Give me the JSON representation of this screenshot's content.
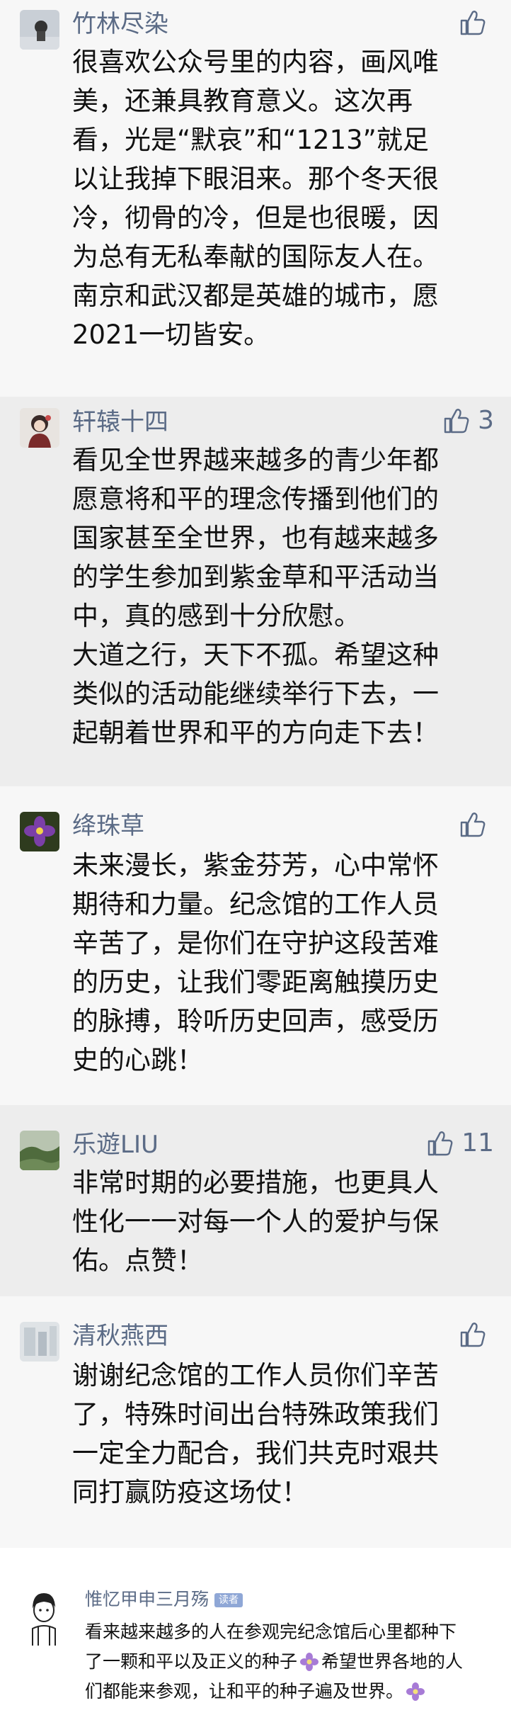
{
  "comments": [
    {
      "name": "竹林尽染",
      "likes": "",
      "lines": [
        "很喜欢公众号里的内容，画风唯",
        "美，还兼具教育意义。这次再",
        "看，光是“默哀”和“1213”就足",
        "以让我掉下眼泪来。那个冬天很",
        "冷，彻骨的冷，但是也很暖，因",
        "为总有无私奉献的国际友人在。",
        "南京和武汉都是英雄的城市，愿",
        "2021一切皆安。"
      ]
    },
    {
      "name": "轩辕十四",
      "likes": "3",
      "lines": [
        "看见全世界越来越多的青少年都",
        "愿意将和平的理念传播到他们的",
        "国家甚至全世界，也有越来越多",
        "的学生参加到紫金草和平活动当",
        "中，真的感到十分欣慰。",
        "大道之行，天下不孤。希望这种",
        "类似的活动能继续举行下去，一",
        "起朝着世界和平的方向走下去！"
      ]
    },
    {
      "name": "绛珠草",
      "likes": "",
      "lines": [
        "未来漫长，紫金芬芳，心中常怀",
        "期待和力量。纪念馆的工作人员",
        "辛苦了，是你们在守护这段苦难",
        "的历史，让我们零距离触摸历史",
        "的脉搏，聆听历史回声，感受历",
        "史的心跳！"
      ]
    },
    {
      "name": "乐遊LIU",
      "likes": "11",
      "lines": [
        "非常时期的必要措施，也更具人",
        "性化一一对每一个人的爱护与保",
        "佑。点赞！"
      ]
    },
    {
      "name": "清秋燕西",
      "likes": "",
      "lines": [
        "谢谢纪念馆的工作人员你们辛苦",
        "了，特殊时间出台特殊政策我们",
        "一定全力配合，我们共克时艰共",
        "同打赢防疫这场仗！"
      ]
    }
  ],
  "last_comment": {
    "name": "惟忆甲申三月殇",
    "badge": "读者",
    "line1": "看来越来越多的人在参观完纪念馆后心里都种下",
    "line2_a": "了一颗和平以及正义的种子",
    "line2_b": "希望世界各地的人",
    "line3": "们都能来参观，让和平的种子遍及世界。"
  },
  "icons": {
    "like": "thumbs-up-icon",
    "flower": "purple-flower-emoji-icon"
  },
  "colors": {
    "nickname": "#5b6b86",
    "text": "#111111",
    "background_alt_a": "#f7f7f7",
    "background_alt_b": "#ededed"
  }
}
